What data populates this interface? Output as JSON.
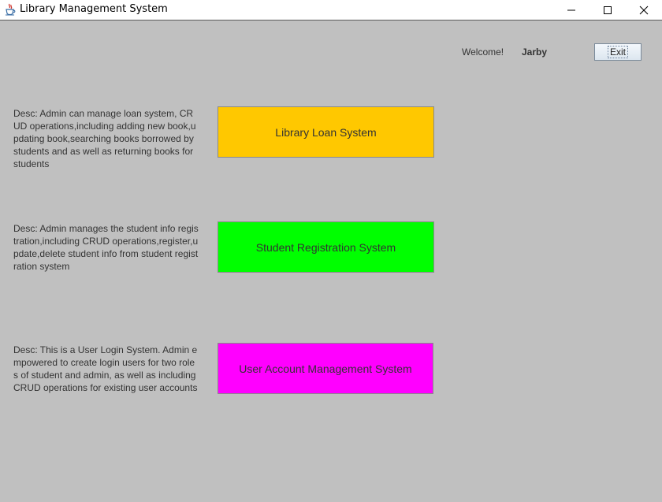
{
  "window": {
    "title": "Library Management System"
  },
  "header": {
    "welcome_label": "Welcome!",
    "username": "Jarby",
    "exit_label": "Exit"
  },
  "systems": [
    {
      "description": "Desc: Admin can manage loan system, CRUD operations,including adding new book,updating book,searching books borrowed by students and as well as returning books for students",
      "button_label": "Library Loan System",
      "color": "#ffc800"
    },
    {
      "description": "Desc: Admin manages the student info registration,including CRUD operations,register,update,delete student info from student registration system",
      "button_label": "Student Registration System",
      "color": "#00ff00"
    },
    {
      "description": "Desc: This is a User Login System. Admin empowered to  create login users for two roles of student and admin, as well as including CRUD operations  for existing user accounts",
      "button_label": "User Account Management System",
      "color": "#ff00ff"
    }
  ]
}
